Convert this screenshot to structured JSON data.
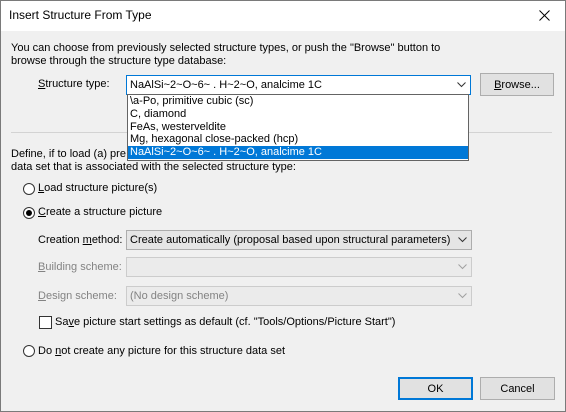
{
  "window": {
    "title": "Insert Structure From Type",
    "close_glyph": "✕"
  },
  "intro": {
    "line1": "You can choose from previously selected structure types, or push the \"Browse\" button to",
    "line2": "browse through the structure type database:"
  },
  "structure_type": {
    "label_prefix": "",
    "label_hotkey": "S",
    "label_rest": "tructure type:",
    "selected": "NaAlSi~2~O~6~ . H~2~O, analcime 1C",
    "options": [
      "\\a-Po, primitive cubic (sc)",
      "C, diamond",
      "FeAs, westerveldite",
      "Mg, hexagonal close-packed (hcp)",
      "NaAlSi~2~O~6~ . H~2~O, analcime 1C"
    ],
    "selected_index": 4,
    "browse_prefix": "",
    "browse_hotkey": "B",
    "browse_rest": "rowse..."
  },
  "define": {
    "line1_visible": "Define, if to load (a) pre",
    "line2": "data set that is associated with the selected structure type:"
  },
  "options": {
    "load_prefix": "",
    "load_hotkey": "L",
    "load_rest": "oad structure picture(s)",
    "load_selected": false,
    "create_prefix": "",
    "create_hotkey": "C",
    "create_rest": "reate a structure picture",
    "create_selected": true,
    "none_prefix": "Do ",
    "none_hotkey": "n",
    "none_rest": "ot create any picture for this structure data set",
    "none_selected": false
  },
  "creation": {
    "method_prefix": "Creation ",
    "method_hotkey": "m",
    "method_rest": "ethod:",
    "method_value": "Create automatically (proposal based upon structural parameters)",
    "building_prefix": "",
    "building_hotkey": "B",
    "building_rest": "uilding scheme:",
    "building_value": "",
    "design_prefix": "",
    "design_hotkey": "D",
    "design_rest": "esign scheme:",
    "design_value": "(No design scheme)"
  },
  "save_settings": {
    "prefix": "Sa",
    "hotkey": "v",
    "rest": "e picture start settings as default (cf. \"Tools/Options/Picture Start\")",
    "checked": false
  },
  "footer": {
    "ok_label": "OK",
    "cancel_label": "Cancel"
  }
}
